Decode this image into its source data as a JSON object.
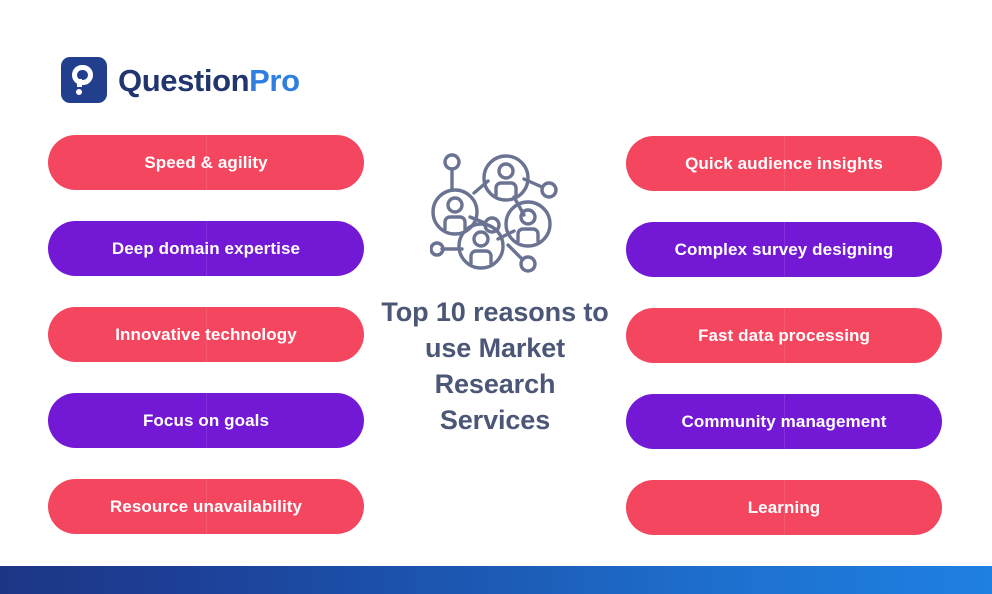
{
  "brand": {
    "logo_icon": "questionpro-p-mark-icon",
    "name_part1": "Question",
    "name_part2": "Pro",
    "navy": "#22356e",
    "blue": "#2f7fe0"
  },
  "center": {
    "icon": "people-network-icon",
    "icon_color": "#6b7393",
    "title": "Top 10 reasons to use Market Research Services",
    "title_lines": [
      "Top 10",
      "reasons to use",
      "Market",
      "Research",
      "Services"
    ],
    "title_color": "#4c5778"
  },
  "colors": {
    "pink": "#f4465f",
    "purple": "#7319d6",
    "background": "#ffffff",
    "bar_start": "#1d3585",
    "bar_end": "#1f80e2"
  },
  "left_column": [
    {
      "label": "Speed & agility",
      "color": "pink"
    },
    {
      "label": "Deep domain expertise",
      "color": "purple"
    },
    {
      "label": "Innovative technology",
      "color": "pink"
    },
    {
      "label": "Focus on goals",
      "color": "purple"
    },
    {
      "label": "Resource unavailability",
      "color": "pink"
    }
  ],
  "right_column": [
    {
      "label": "Quick audience insights",
      "color": "pink"
    },
    {
      "label": "Complex survey designing",
      "color": "purple"
    },
    {
      "label": "Fast data processing",
      "color": "pink"
    },
    {
      "label": "Community management",
      "color": "purple"
    },
    {
      "label": "Learning",
      "color": "pink"
    }
  ],
  "bottom_bar": {
    "name": "footer-gradient-bar"
  }
}
